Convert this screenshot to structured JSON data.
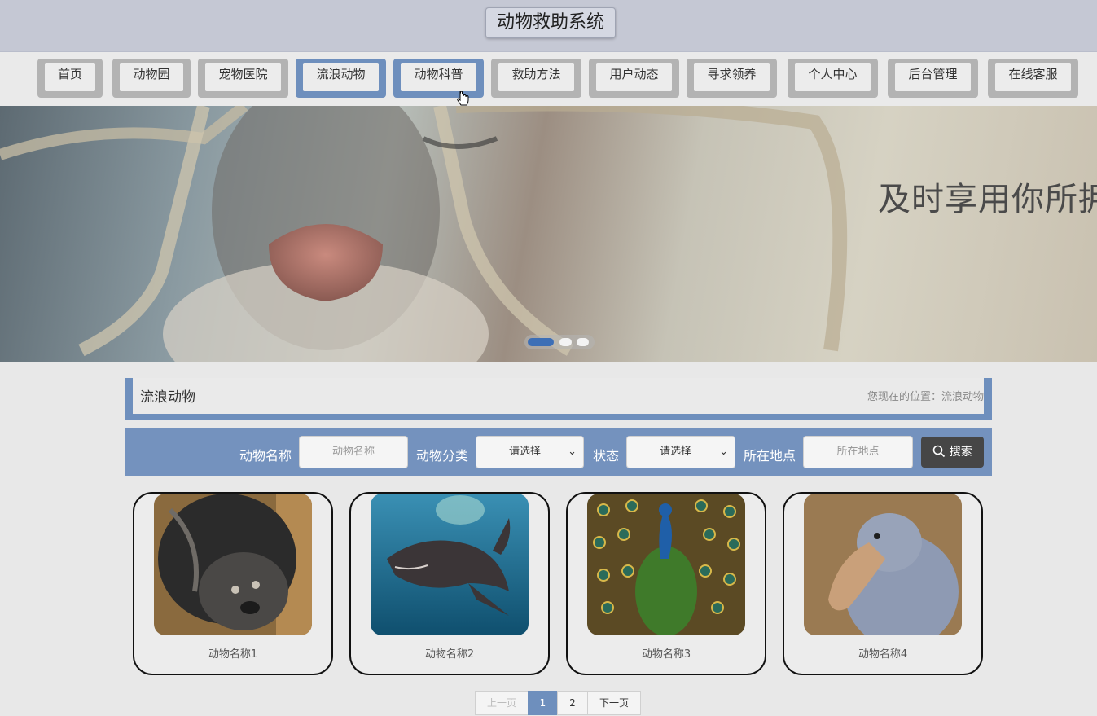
{
  "header": {
    "title": "动物救助系统"
  },
  "nav": {
    "items": [
      {
        "label": "首页"
      },
      {
        "label": "动物园"
      },
      {
        "label": "宠物医院"
      },
      {
        "label": "流浪动物"
      },
      {
        "label": "动物科普"
      },
      {
        "label": "救助方法"
      },
      {
        "label": "用户动态"
      },
      {
        "label": "寻求领养"
      },
      {
        "label": "个人中心"
      },
      {
        "label": "后台管理"
      },
      {
        "label": "在线客服"
      }
    ],
    "active": [
      "流浪动物",
      "动物科普"
    ]
  },
  "banner": {
    "text": "及时享用你所拥",
    "slides": 3,
    "active_slide": 1
  },
  "section": {
    "title": "流浪动物",
    "breadcrumb": "您现在的位置：流浪动物"
  },
  "search": {
    "name_label": "动物名称",
    "name_placeholder": "动物名称",
    "category_label": "动物分类",
    "category_value": "请选择",
    "status_label": "状态",
    "status_value": "请选择",
    "location_label": "所在地点",
    "location_placeholder": "所在地点",
    "button_label": "搜索"
  },
  "cards": [
    {
      "name": "动物名称1"
    },
    {
      "name": "动物名称2"
    },
    {
      "name": "动物名称3"
    },
    {
      "name": "动物名称4"
    }
  ],
  "pagination": {
    "prev": "上一页",
    "pages": [
      "1",
      "2"
    ],
    "current": "1",
    "next": "下一页"
  },
  "colors": {
    "accent": "#6e8fbd",
    "search_bar": "#7492be",
    "button_dark": "#464646"
  }
}
